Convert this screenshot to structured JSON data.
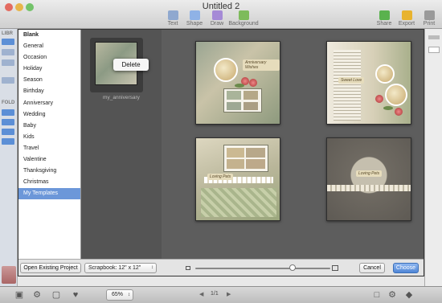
{
  "window": {
    "title": "Untitled 2"
  },
  "toolbar": {
    "left_tools": [
      {
        "label": "Text",
        "icon": "text-icon",
        "color": "#8fa8cf"
      },
      {
        "label": "Shape",
        "icon": "shape-icon",
        "color": "#8fb2e6"
      },
      {
        "label": "Draw",
        "icon": "draw-icon",
        "color": "#a58ad6"
      },
      {
        "label": "Background",
        "icon": "background-icon",
        "color": "#7dbb5b"
      }
    ],
    "right_tools": [
      {
        "label": "Share",
        "icon": "share-icon",
        "color": "#5ab24e"
      },
      {
        "label": "Export",
        "icon": "export-icon",
        "color": "#e8b32e"
      },
      {
        "label": "Print",
        "icon": "print-icon",
        "color": "#9a9a9a"
      }
    ]
  },
  "sidebar": {
    "library_label": "LIBR",
    "folders_label": "FOLD"
  },
  "categories": {
    "items": [
      "Blank",
      "General",
      "Occasion",
      "Holiday",
      "Season",
      "Birthday",
      "Anniversary",
      "Wedding",
      "Baby",
      "Kids",
      "Travel",
      "Valentine",
      "Thanksgiving",
      "Christmas",
      "My Templates"
    ],
    "selected_index": 14,
    "bold_index": 0
  },
  "my_templates": {
    "items": [
      {
        "name": "my_anniversary"
      }
    ],
    "context_menu": {
      "delete_label": "Delete"
    }
  },
  "gallery": {
    "templates": [
      {
        "label": "Anniversary Wishes"
      },
      {
        "label": "Sweet Love"
      },
      {
        "label": "Loving Pets"
      },
      {
        "label": "Loving Pets"
      }
    ]
  },
  "sheet_footer": {
    "open_existing_label": "Open Existing Project",
    "scrapbook_size": "Scrapbook: 12\" x 12\"",
    "thumbnail_size_fraction": 0.72,
    "cancel_label": "Cancel",
    "choose_label": "Choose"
  },
  "bottom_bar": {
    "zoom": "65%",
    "page_indicator": "1/1"
  },
  "colors": {
    "accent": "#6c97d9",
    "primary_button": "#4f86d6"
  }
}
